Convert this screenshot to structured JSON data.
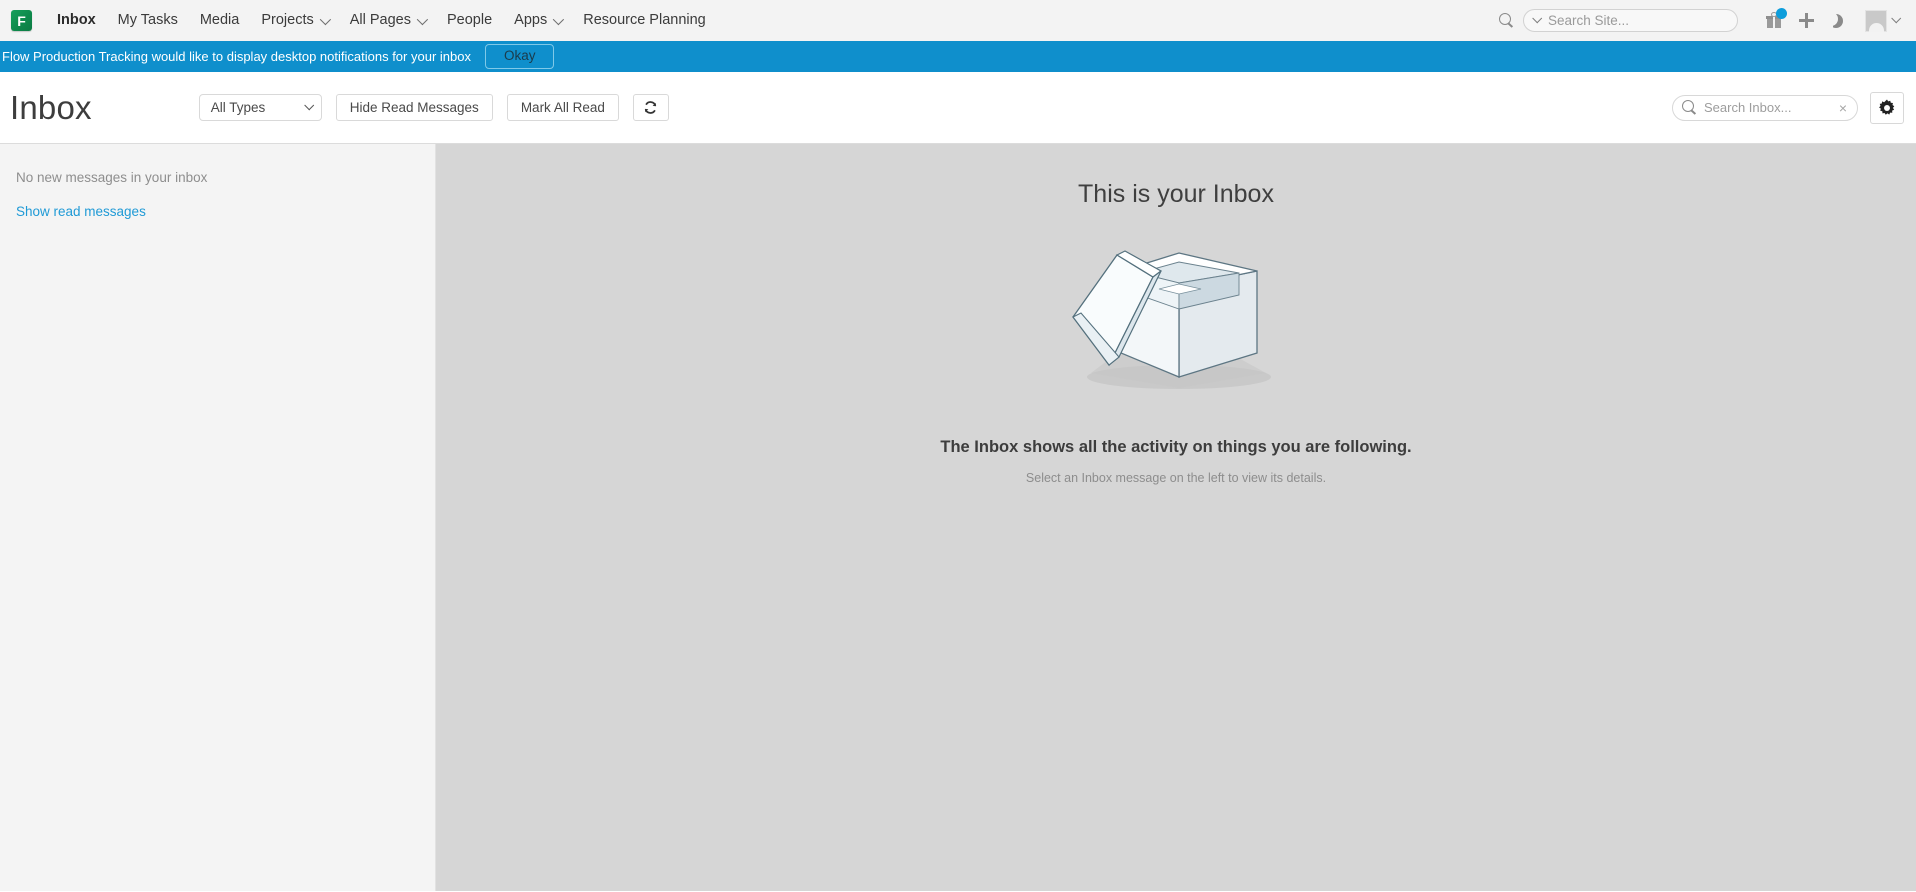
{
  "brand": {
    "logo_letter": "F",
    "logo_color": "#0e8a4c",
    "accent_blue": "#0f8fcc",
    "link_blue": "#1f9ad6",
    "notification_dot_color": "#0d9ddb"
  },
  "top_nav": {
    "items": [
      {
        "label": "Inbox",
        "active": true,
        "has_caret": false,
        "name": "nav-item-inbox"
      },
      {
        "label": "My Tasks",
        "active": false,
        "has_caret": false,
        "name": "nav-item-my-tasks"
      },
      {
        "label": "Media",
        "active": false,
        "has_caret": false,
        "name": "nav-item-media"
      },
      {
        "label": "Projects",
        "active": false,
        "has_caret": true,
        "name": "nav-item-projects"
      },
      {
        "label": "All Pages",
        "active": false,
        "has_caret": true,
        "name": "nav-item-all-pages"
      },
      {
        "label": "People",
        "active": false,
        "has_caret": false,
        "name": "nav-item-people"
      },
      {
        "label": "Apps",
        "active": false,
        "has_caret": true,
        "name": "nav-item-apps"
      },
      {
        "label": "Resource Planning",
        "active": false,
        "has_caret": false,
        "name": "nav-item-resource-planning"
      }
    ],
    "site_search": {
      "placeholder": "Search Site...",
      "value": ""
    },
    "icons": [
      "search-icon",
      "gift-icon",
      "plus-icon",
      "moon-icon",
      "avatar-icon",
      "chevron-down-icon"
    ]
  },
  "banner": {
    "message": "Flow Production Tracking would like to display desktop notifications for your inbox",
    "okay_label": "Okay"
  },
  "toolbar": {
    "title": "Inbox",
    "type_filter": {
      "selected": "All Types",
      "options": [
        "All Types"
      ]
    },
    "hide_read_label": "Hide Read Messages",
    "mark_all_read_label": "Mark All Read",
    "refresh_icon": "refresh-icon",
    "inbox_search": {
      "placeholder": "Search Inbox...",
      "value": "",
      "clear_glyph": "×"
    },
    "settings_icon": "gear-icon"
  },
  "sidebar": {
    "empty_message": "No new messages in your inbox",
    "show_read_label": "Show read messages"
  },
  "main": {
    "heading": "This is your Inbox",
    "illustration": "open-empty-box-illustration",
    "subtitle": "The Inbox shows all the activity on things you are following.",
    "hint": "Select an Inbox message on the left to view its details."
  }
}
